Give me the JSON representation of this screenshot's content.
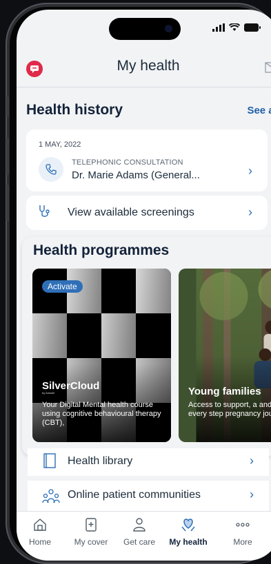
{
  "header": {
    "title": "My health"
  },
  "status": {
    "signal": "signal-icon",
    "wifi": "wifi-icon",
    "battery": "battery-icon"
  },
  "health_history": {
    "title": "Health history",
    "see_all": "See all",
    "entry": {
      "date": "1 MAY, 2022",
      "type": "TELEPHONIC CONSULTATION",
      "doctor": "Dr. Marie Adams (General..."
    }
  },
  "screenings": {
    "label": "View available screenings"
  },
  "programmes": {
    "title": "Health programmes",
    "cards": [
      {
        "badge": "Activate",
        "name": "SilverCloud",
        "sub": "by Amwell",
        "desc": "Your Digital Mental health course using cognitive behavioural therapy (CBT),"
      },
      {
        "name": "Young families",
        "desc": "Access to support, a and tools every step pregnancy journey."
      }
    ]
  },
  "library": {
    "label": "Health library"
  },
  "communities": {
    "label": "Online patient communities"
  },
  "nav": {
    "items": [
      "Home",
      "My cover",
      "Get care",
      "My health",
      "More"
    ]
  },
  "colors": {
    "accent": "#1f5fa8",
    "chat": "#e02a4a",
    "badge": "#2f6fb8"
  }
}
